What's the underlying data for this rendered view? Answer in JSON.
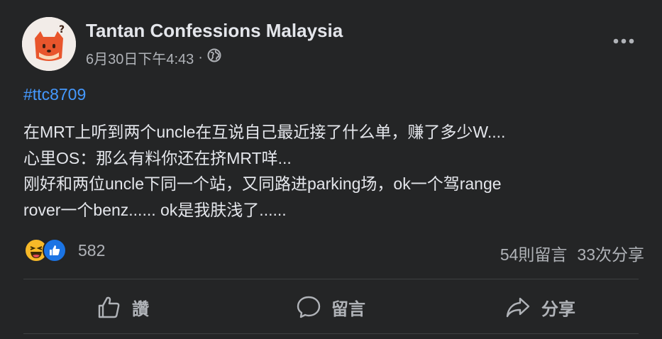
{
  "post": {
    "page_name": "Tantan Confessions Malaysia",
    "timestamp": "6月30日下午4:43",
    "separator": "·",
    "audience_icon": "globe-icon",
    "hashtag": "#ttc8709",
    "lines": [
      "在MRT上听到两个uncle在互说自己最近接了什么单，赚了多少W....",
      "心里OS：那么有料你还在挤MRT咩...",
      "刚好和两位uncle下同一个站，又同路进parking场，ok一个驾range",
      "rover一个benz...... ok是我肤浅了......"
    ]
  },
  "stats": {
    "reaction_icons": [
      "haha-icon",
      "like-icon"
    ],
    "reaction_count": "582",
    "comments": "54則留言",
    "shares": "33次分享"
  },
  "actions": {
    "like": "讚",
    "comment": "留言",
    "share": "分享"
  },
  "colors": {
    "background": "#242526",
    "text_primary": "#e4e6eb",
    "text_secondary": "#b0b3b8",
    "hashtag": "#4599ff",
    "like_blue": "#1b74e4",
    "haha_yellow": "#f7b928",
    "avatar_orange": "#e8552c"
  }
}
